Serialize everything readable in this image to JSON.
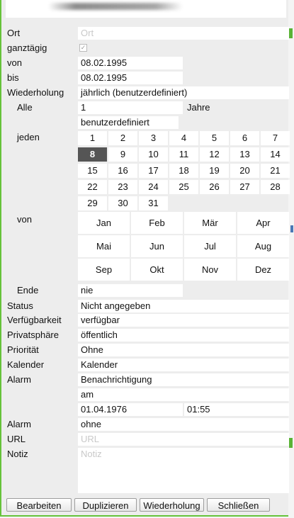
{
  "form": {
    "ort": {
      "label": "Ort",
      "placeholder": "Ort"
    },
    "ganztaegig": {
      "label": "ganztägig",
      "checked": true
    },
    "von": {
      "label": "von",
      "value": "08.02.1995"
    },
    "bis": {
      "label": "bis",
      "value": "08.02.1995"
    },
    "wiederholung": {
      "label": "Wiederholung",
      "value": "jährlich (benutzerdefiniert)"
    },
    "alle": {
      "label": "Alle",
      "value": "1",
      "unit": "Jahre"
    },
    "mode": {
      "value": "benutzerdefiniert"
    },
    "jeden": {
      "label": "jeden",
      "days": [
        "1",
        "2",
        "3",
        "4",
        "5",
        "6",
        "7",
        "8",
        "9",
        "10",
        "11",
        "12",
        "13",
        "14",
        "15",
        "16",
        "17",
        "18",
        "19",
        "20",
        "21",
        "22",
        "23",
        "24",
        "25",
        "26",
        "27",
        "28",
        "29",
        "30",
        "31"
      ],
      "selected_day": "8"
    },
    "monate": {
      "label": "von",
      "months": [
        "Jan",
        "Feb",
        "Mär",
        "Apr",
        "Mai",
        "Jun",
        "Jul",
        "Aug",
        "Sep",
        "Okt",
        "Nov",
        "Dez"
      ]
    },
    "ende": {
      "label": "Ende",
      "value": "nie"
    },
    "status": {
      "label": "Status",
      "value": "Nicht angegeben"
    },
    "verfuegbarkeit": {
      "label": "Verfügbarkeit",
      "value": "verfügbar"
    },
    "privatsphaere": {
      "label": "Privatsphäre",
      "value": "öffentlich"
    },
    "prioritaet": {
      "label": "Priorität",
      "value": "Ohne"
    },
    "kalender": {
      "label": "Kalender",
      "value": "Kalender"
    },
    "alarm1": {
      "label": "Alarm",
      "value": "Benachrichtigung",
      "when": "am",
      "date": "01.04.1976",
      "time": "01:55"
    },
    "alarm2": {
      "label": "Alarm",
      "value": "ohne"
    },
    "url": {
      "label": "URL",
      "placeholder": "URL"
    },
    "notiz": {
      "label": "Notiz",
      "placeholder": "Notiz"
    }
  },
  "buttons": {
    "edit": "Bearbeiten",
    "duplicate": "Duplizieren",
    "repeat": "Wiederholung",
    "close": "Schließen"
  },
  "colors": {
    "accent_green": "#66c23a",
    "selected_day": "#555555"
  }
}
